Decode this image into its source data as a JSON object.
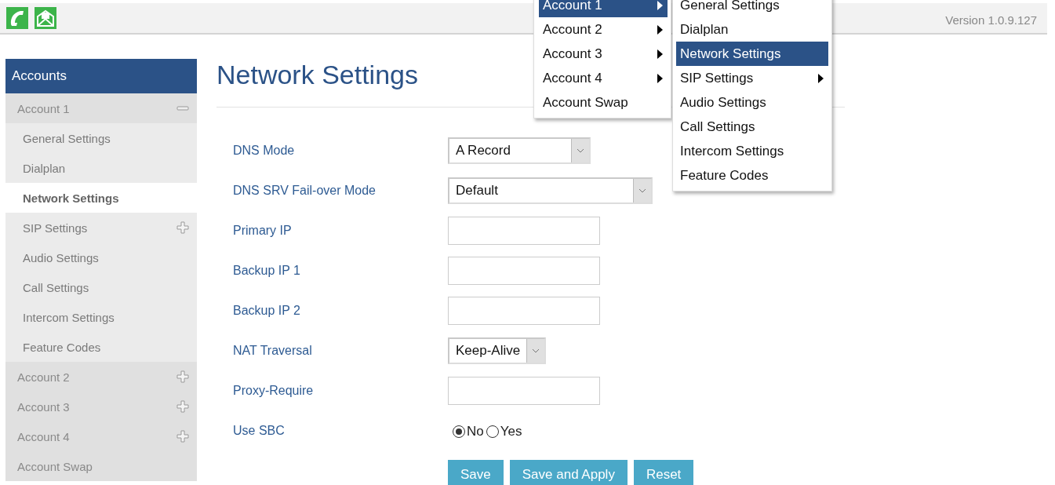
{
  "header": {
    "version": "Version 1.0.9.127"
  },
  "sidebar": {
    "title": "Accounts",
    "items": [
      {
        "label": "Account 1",
        "kind": "account",
        "expanded": true,
        "selected": false,
        "children": [
          {
            "label": "General Settings",
            "kind": "page",
            "selected": false
          },
          {
            "label": "Dialplan",
            "kind": "page",
            "selected": false
          },
          {
            "label": "Network Settings",
            "kind": "page",
            "selected": true
          },
          {
            "label": "SIP Settings",
            "kind": "page",
            "expanded": false,
            "selected": false
          },
          {
            "label": "Audio Settings",
            "kind": "page",
            "selected": false
          },
          {
            "label": "Call Settings",
            "kind": "page",
            "selected": false
          },
          {
            "label": "Intercom Settings",
            "kind": "page",
            "selected": false
          },
          {
            "label": "Feature Codes",
            "kind": "page",
            "selected": false
          }
        ]
      },
      {
        "label": "Account 2",
        "kind": "account",
        "expanded": false,
        "selected": false
      },
      {
        "label": "Account 3",
        "kind": "account",
        "expanded": false,
        "selected": false
      },
      {
        "label": "Account 4",
        "kind": "account",
        "expanded": false,
        "selected": false
      },
      {
        "label": "Account Swap",
        "kind": "account",
        "selected": false
      }
    ]
  },
  "page": {
    "title": "Network Settings",
    "fields": [
      {
        "label": "DNS Mode",
        "kind": "select",
        "value": "A Record"
      },
      {
        "label": "DNS SRV Fail-over Mode",
        "kind": "select",
        "value": "Default"
      },
      {
        "label": "Primary IP",
        "kind": "text"
      },
      {
        "label": "Backup IP 1",
        "kind": "text"
      },
      {
        "label": "Backup IP 2",
        "kind": "text"
      },
      {
        "label": "NAT Traversal",
        "kind": "select",
        "value": "Keep-Alive"
      },
      {
        "label": "Proxy-Require",
        "kind": "text"
      },
      {
        "label": "Use SBC",
        "kind": "radio",
        "options": [
          {
            "label": "No",
            "selected": true
          },
          {
            "label": "Yes",
            "selected": false
          }
        ]
      }
    ],
    "buttons": [
      "Save",
      "Save and Apply",
      "Reset"
    ]
  },
  "menus": [
    {
      "items": [
        {
          "label": "Account 1",
          "submenu": true,
          "selected": true
        },
        {
          "label": "Account 2",
          "submenu": true,
          "selected": false
        },
        {
          "label": "Account 3",
          "submenu": true,
          "selected": false
        },
        {
          "label": "Account 4",
          "submenu": true,
          "selected": false
        },
        {
          "label": "Account Swap",
          "submenu": false,
          "selected": false
        }
      ]
    },
    {
      "items": [
        {
          "label": "General Settings",
          "submenu": false,
          "selected": false
        },
        {
          "label": "Dialplan",
          "submenu": false,
          "selected": false
        },
        {
          "label": "Network Settings",
          "submenu": false,
          "selected": true
        },
        {
          "label": "SIP Settings",
          "submenu": true,
          "selected": false
        },
        {
          "label": "Audio Settings",
          "submenu": false,
          "selected": false
        },
        {
          "label": "Call Settings",
          "submenu": false,
          "selected": false
        },
        {
          "label": "Intercom Settings",
          "submenu": false,
          "selected": false
        },
        {
          "label": "Feature Codes",
          "submenu": false,
          "selected": false
        }
      ]
    }
  ]
}
